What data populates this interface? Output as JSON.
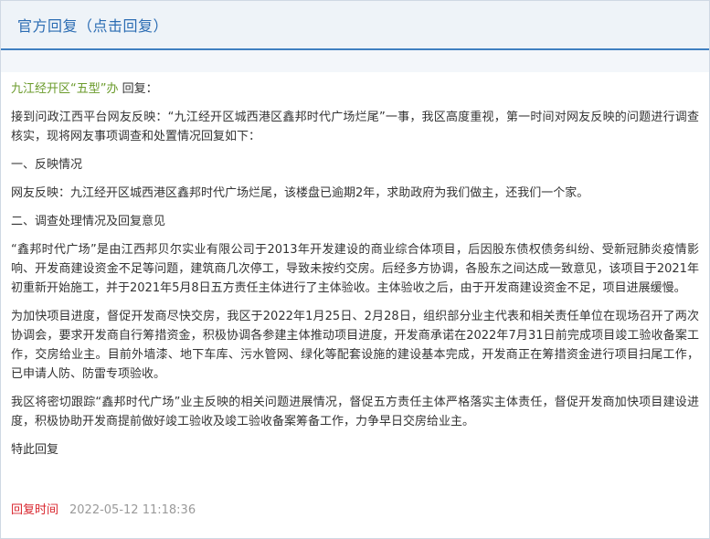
{
  "header": {
    "title": "官方回复",
    "title_link": "（点击回复）"
  },
  "reply": {
    "org": "九江经开区“五型”办",
    "org_suffix": " 回复：",
    "paragraphs": [
      "接到问政江西平台网友反映：“九江经开区城西港区鑫邦时代广场烂尾”一事，我区高度重视，第一时间对网友反映的问题进行调查核实，现将网友事项调查和处置情况回复如下：",
      "一、反映情况",
      "网友反映：九江经开区城西港区鑫邦时代广场烂尾，该楼盘已逾期2年，求助政府为我们做主，还我们一个家。",
      "二、调查处理情况及回复意见",
      "“鑫邦时代广场”是由江西邦贝尔实业有限公司于2013年开发建设的商业综合体项目，后因股东债权债务纠纷、受新冠肺炎疫情影响、开发商建设资金不足等问题，建筑商几次停工，导致未按约交房。后经多方协调，各股东之间达成一致意见，该项目于2021年初重新开始施工，并于2021年5月8日五方责任主体进行了主体验收。主体验收之后，由于开发商建设资金不足，项目进展缓慢。",
      "为加快项目进度，督促开发商尽快交房，我区于2022年1月25日、2月28日，组织部分业主代表和相关责任单位在现场召开了两次协调会，要求开发商自行筹措资金，积极协调各参建主体推动项目进度，开发商承诺在2022年7月31日前完成项目竣工验收备案工作，交房给业主。目前外墙漆、地下车库、污水管网、绿化等配套设施的建设基本完成，开发商正在筹措资金进行项目扫尾工作，已申请人防、防雷专项验收。",
      "我区将密切跟踪“鑫邦时代广场”业主反映的相关问题进展情况，督促五方责任主体严格落实主体责任，督促开发商加快项目建设进度，积极协助开发商提前做好竣工验收及竣工验收备案筹备工作，力争早日交房给业主。",
      "特此回复"
    ],
    "time_label": "回复时间",
    "time_value": "2022-05-12 11:18:36"
  },
  "colors": {
    "header_text": "#2b6cb3",
    "header_border": "#3f7fc0",
    "org_text": "#6a9a2a",
    "time_label": "#d9262e",
    "time_value": "#9a9a9a"
  }
}
